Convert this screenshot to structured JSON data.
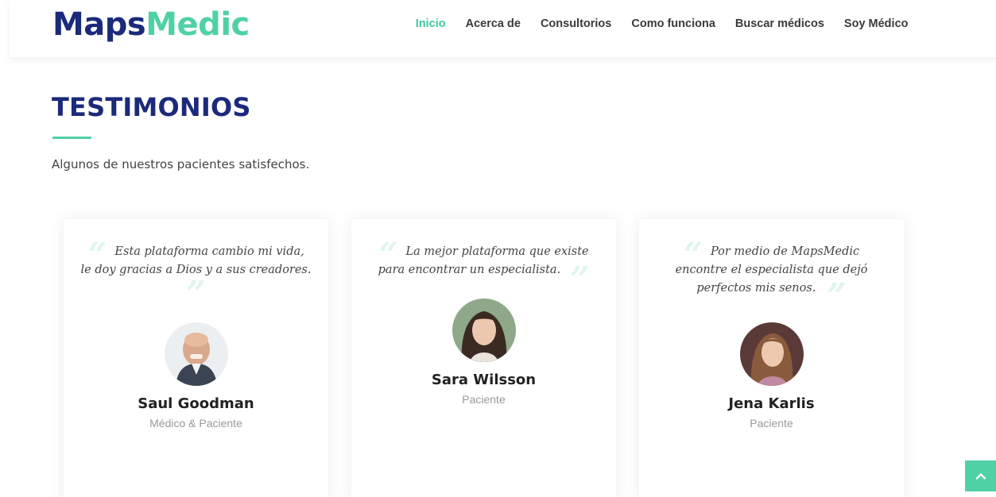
{
  "header": {
    "logo_part1": "Maps",
    "logo_part2": "Medic",
    "nav": [
      "Inicio",
      "Acerca de",
      "Consultorios",
      "Como funciona",
      "Buscar médicos",
      "Soy Médico"
    ],
    "active_nav": "Inicio"
  },
  "section": {
    "title": "TESTIMONIOS",
    "subtitle": "Algunos de nuestros pacientes satisfechos."
  },
  "testimonials": [
    {
      "quote_line1": "Esta plataforma cambio mi vida,",
      "quote_line2": "le doy gracias a Dios y a sus creadores.",
      "quote_line3": "",
      "name": "Saul Goodman",
      "role": "Médico & Paciente"
    },
    {
      "quote_line1": "La mejor plataforma que existe",
      "quote_line2": "para encontrar un especialista.",
      "quote_line3": "",
      "name": "Sara Wilsson",
      "role": "Paciente"
    },
    {
      "quote_line1": "Por medio de MapsMedic",
      "quote_line2": "encontre el especialista que dejó",
      "quote_line3": "perfectos mis senos.",
      "name": "Jena Karlis",
      "role": "Paciente"
    }
  ],
  "colors": {
    "brand_navy": "#1b2a7a",
    "brand_green": "#4fd1a5",
    "active_link": "#3cc8a0"
  },
  "icons": {
    "back_to_top": "chevron-up-icon",
    "quote_open": "quote-open-icon",
    "quote_close": "quote-close-icon"
  }
}
